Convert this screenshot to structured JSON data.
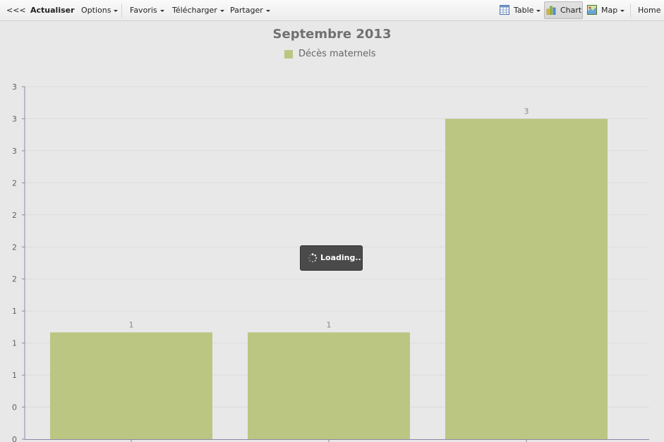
{
  "toolbar": {
    "back": "<<<",
    "refresh": "Actualiser",
    "options": "Options",
    "favorites": "Favoris",
    "download": "Télécharger",
    "share": "Partager",
    "table": "Table",
    "chart": "Chart",
    "map": "Map",
    "home": "Home"
  },
  "loading_text": "Loading..",
  "chart_data": {
    "type": "bar",
    "title": "Septembre 2013",
    "categories": [
      "",
      "",
      ""
    ],
    "series": [
      {
        "name": "Décès maternels",
        "values": [
          1,
          1,
          3
        ],
        "color": "#bbc683"
      }
    ],
    "data_labels": [
      "1",
      "1",
      "3"
    ],
    "ytick_labels": [
      "0",
      "0",
      "1",
      "1",
      "1",
      "2",
      "2",
      "2",
      "2",
      "3",
      "3",
      "3"
    ],
    "ylim": [
      0,
      3.3
    ],
    "xlabel": "",
    "ylabel": "",
    "grid": true,
    "legend": "top-center"
  }
}
